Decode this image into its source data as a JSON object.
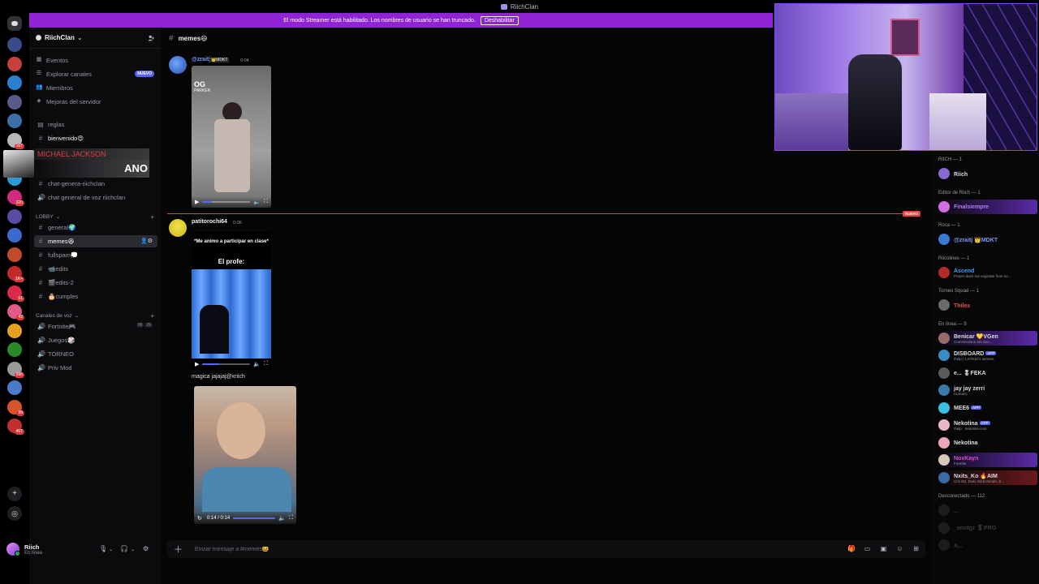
{
  "window": {
    "title": "RiichClan"
  },
  "banner": {
    "text": "El modo Streamer está habilitado. Los nombres de usuario se han truncado.",
    "button": "Deshabilitar"
  },
  "rail": {
    "servers": [
      {
        "badge": "",
        "color": "#3a4a8a"
      },
      {
        "badge": "",
        "color": "#c83f3f"
      },
      {
        "badge": "",
        "color": "#2b7fcf"
      },
      {
        "badge": "",
        "color": "#5a5a8a"
      },
      {
        "badge": "",
        "color": "#3c6ea8"
      },
      {
        "badge": "167",
        "color": "#b8b8b8"
      },
      {
        "badge": "102",
        "color": "#c8334a"
      },
      {
        "badge": "",
        "color": "#2a9ad0"
      },
      {
        "badge": "320",
        "color": "#d12b7f"
      },
      {
        "badge": "",
        "color": "#5a4aa0"
      },
      {
        "badge": "",
        "color": "#3a6ad0"
      },
      {
        "badge": "",
        "color": "#c04a2a"
      },
      {
        "badge": "1K+",
        "color": "#c02a2a"
      },
      {
        "badge": "61",
        "color": "#d82a4a"
      },
      {
        "badge": "42",
        "color": "#e05a8a"
      },
      {
        "badge": "",
        "color": "#e8a020"
      },
      {
        "badge": "",
        "color": "#2a8a2a"
      },
      {
        "badge": "396",
        "color": "#9a9a9a"
      },
      {
        "badge": "",
        "color": "#4a7ac8"
      },
      {
        "badge": "99",
        "color": "#d8542a"
      },
      {
        "badge": "467",
        "color": "#c03030"
      }
    ]
  },
  "sidebar": {
    "server_name": "RiichClan",
    "nav": [
      {
        "label": "Eventos"
      },
      {
        "label": "Explorar canales",
        "tag": "NUEVO"
      },
      {
        "label": "Miembros"
      },
      {
        "label": "Mejoras del servidor"
      }
    ],
    "channels_top": [
      {
        "label": "reglas"
      },
      {
        "label": "bienvenido😍"
      }
    ],
    "mj_overlay": {
      "line1": "MICHAEL JACKSON",
      "line2": "ANO"
    },
    "channels_mid": [
      {
        "label": "chat-genera-riichclan"
      },
      {
        "label": "chat general de voz riichclan"
      }
    ],
    "lobby_category": "LOBBY",
    "lobby_channels": [
      {
        "label": "general🌍"
      },
      {
        "label": "memes😆"
      },
      {
        "label": "fullspam💭"
      },
      {
        "label": "📹edits"
      },
      {
        "label": "🎬edits-2"
      },
      {
        "label": "🎂cumples"
      }
    ],
    "voice_category": "Canales de voz",
    "voice_channels": [
      {
        "label": "Fortnite🎮",
        "count_a": "00",
        "count_b": "29"
      },
      {
        "label": "Juegos🎲"
      },
      {
        "label": "TORNEO"
      },
      {
        "label": "Priv Mod"
      }
    ],
    "user": {
      "name": "Riich",
      "status": "En línea"
    }
  },
  "channel": {
    "name": "memes😆",
    "messages": [
      {
        "author": "@zraitj",
        "badge": "👑MDKT",
        "time": "0:04"
      },
      {
        "author": "patitorochi64",
        "time": "0:06",
        "video_title": "*Me animo a participar en clase*",
        "video_sub": "El profe:",
        "caption": "magica jajajaj@xriich",
        "video_time": "0:14 / 0:14"
      }
    ],
    "video1": {
      "tag_line1": "OG",
      "tag_line2": "PARKER"
    },
    "new_label": "NUEVO",
    "composer_placeholder": "Enviar mensaje a #memes😆"
  },
  "members": {
    "groups": [
      {
        "role": "RIICH — 1",
        "members": [
          {
            "name": "Riich",
            "color": "#dbdee1"
          }
        ]
      },
      {
        "role": "Editor de Riich — 1",
        "members": [
          {
            "name": "Finalsiempre",
            "color": "#b57bff"
          }
        ]
      },
      {
        "role": "Roca — 1",
        "members": [
          {
            "name": "@zraitj 👑MDKT",
            "color": "#7a9aff"
          }
        ]
      },
      {
        "role": "Riicolines — 1",
        "members": [
          {
            "name": "Ascend",
            "color": "#3aa0ff",
            "sub": "Prayer does not originate from so..."
          }
        ]
      },
      {
        "role": "Torneo Squad — 1",
        "members": [
          {
            "name": "Thilex",
            "color": "#e84a4a"
          }
        ]
      },
      {
        "role": "En línea — 9",
        "members": [
          {
            "name": "Benicar 💛VGen",
            "color": "#dbdee1",
            "sub": "Commissions are doo..."
          },
          {
            "name": "DISBOARD",
            "tag": "APP",
            "color": "#dbdee1",
            "sub": "/help | 1,579,671 servers"
          },
          {
            "name": "e... 🎖FEKA",
            "color": "#dbdee1"
          },
          {
            "name": "jay jay zerri",
            "color": "#dbdee1",
            "sub": "Humanz"
          },
          {
            "name": "MEE6",
            "tag": "APP",
            "color": "#dbdee1"
          },
          {
            "name": "Nekotina",
            "tag": "APP",
            "color": "#dbdee1",
            "sub": "!help · nekotina.com"
          },
          {
            "name": "Nekotina",
            "color": "#dbdee1"
          },
          {
            "name": "NoxKayn",
            "color": "#e04adb",
            "sub": "Fortnite"
          },
          {
            "name": "Nxits_Ko 🔥AIM",
            "color": "#dbdee1",
            "sub": "Cris MJ, Dukl, Nicki Nicole, S..."
          }
        ]
      },
      {
        "role": "Desconectado — 112",
        "members": [
          {
            "name": "...",
            "color": "#949ba4"
          },
          {
            "name": "_emdgz 🎖PRO",
            "color": "#949ba4"
          },
          {
            "name": "A...",
            "color": "#949ba4"
          }
        ]
      }
    ]
  }
}
